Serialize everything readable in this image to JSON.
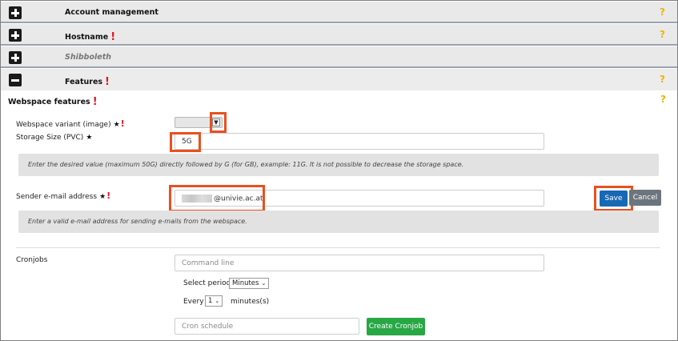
{
  "accordion": [
    {
      "title": "Account management",
      "state": "collapsed",
      "required": false,
      "disabled": false
    },
    {
      "title": "Hostname",
      "state": "collapsed",
      "required": true,
      "disabled": false
    },
    {
      "title": "Shibboleth",
      "state": "collapsed",
      "required": false,
      "disabled": true
    },
    {
      "title": "Features",
      "state": "expanded",
      "required": true,
      "disabled": false
    }
  ],
  "help_glyph": "?",
  "required_glyph": "!",
  "star_glyph": "★",
  "webspace": {
    "section_title": "Webspace features",
    "variant_label": "Webspace variant (image)",
    "storage_label": "Storage Size (PVC)",
    "storage_value": "5G",
    "storage_hint": "Enter the desired value (maximum 50G) directly followed by G (for GB), example: 11G. It is not possible to decrease the storage space.",
    "email_label": "Sender e-mail address",
    "email_value_suffix": "@univie.ac.at",
    "email_hint": "Enter a valid e-mail address for sending e-mails from the webspace.",
    "save_label": "Save",
    "cancel_label": "Cancel"
  },
  "cronjobs": {
    "label": "Cronjobs",
    "command_placeholder": "Command line",
    "period_label": "Select period:",
    "period_value": "Minutes",
    "every_label": "Every",
    "every_value": "1",
    "unit_label": "minutes(s)",
    "schedule_placeholder": "Cron schedule",
    "create_label": "Create Cronjob"
  },
  "colors": {
    "accent": "#1769b5",
    "highlight": "#e8511f",
    "create": "#28a745",
    "help": "#f0b400",
    "required": "#e0141e"
  }
}
